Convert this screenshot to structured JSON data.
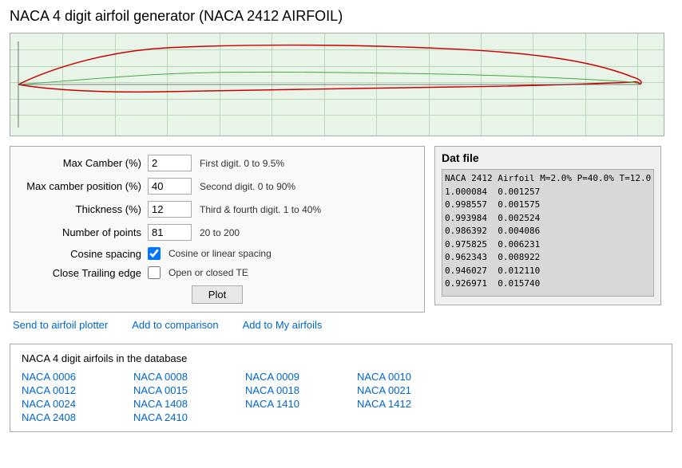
{
  "page": {
    "title": "NACA 4 digit airfoil generator (NACA 2412 AIRFOIL)"
  },
  "form": {
    "max_camber_label": "Max Camber (%)",
    "max_camber_value": "2",
    "max_camber_hint": "First digit. 0 to 9.5%",
    "camber_position_label": "Max camber position (%)",
    "camber_position_value": "40",
    "camber_position_hint": "Second digit. 0 to 90%",
    "thickness_label": "Thickness (%)",
    "thickness_value": "12",
    "thickness_hint": "Third & fourth digit. 1 to 40%",
    "num_points_label": "Number of points",
    "num_points_value": "81",
    "num_points_hint": "20 to 200",
    "cosine_label": "Cosine spacing",
    "cosine_hint": "Cosine or linear spacing",
    "close_te_label": "Close Trailing edge",
    "close_te_hint": "Open or closed TE",
    "plot_button": "Plot"
  },
  "links": {
    "send_to_plotter": "Send to airfoil plotter",
    "add_to_comparison": "Add to comparison",
    "add_to_my_airfoils": "Add to My airfoils"
  },
  "dat_file": {
    "title": "Dat file",
    "header": "NACA 2412 Airfoil M=2.0% P=40.0% T=12.0",
    "rows": [
      "1.000084  0.001257",
      "0.998557  0.001575",
      "0.993984  0.002524",
      "0.986392  0.004086",
      "0.975825  0.006231",
      "0.962343  0.008922",
      "0.946027  0.012110",
      "0.926971  0.015740"
    ]
  },
  "database": {
    "title": "NACA 4 digit airfoils in the database",
    "airfoils": [
      "NACA 0006",
      "NACA 0008",
      "NACA 0009",
      "NACA 0010",
      "NACA 0012",
      "NACA 0015",
      "NACA 0018",
      "NACA 0021",
      "NACA 0024",
      "NACA 1408",
      "NACA 1410",
      "NACA 1412",
      "NACA 2408",
      "NACA 2410"
    ]
  }
}
